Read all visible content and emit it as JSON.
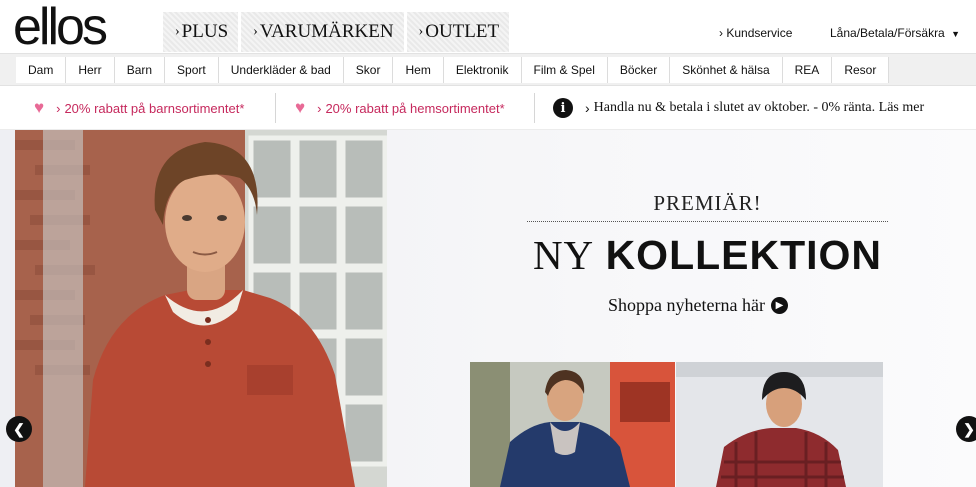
{
  "brand": {
    "logo_text": "ellos"
  },
  "main_tabs": [
    {
      "label": "PLUS"
    },
    {
      "label": "VARUMÄRKEN"
    },
    {
      "label": "OUTLET"
    }
  ],
  "utility": {
    "customer_service": "Kundservice",
    "loan_pay_insure": "Låna/Betala/Försäkra"
  },
  "categories": [
    "Dam",
    "Herr",
    "Barn",
    "Sport",
    "Underkläder & bad",
    "Skor",
    "Hem",
    "Elektronik",
    "Film & Spel",
    "Böcker",
    "Skönhet & hälsa",
    "REA",
    "Resor"
  ],
  "promos": {
    "kids_discount": "20% rabatt på barnsortimentet*",
    "home_discount": "20% rabatt på hemsortimentet*",
    "pay_later": "Handla nu & betala i slutet av oktober. - 0% ränta. Läs mer"
  },
  "hero": {
    "eyebrow": "PREMIÄR!",
    "headline_light": "NY",
    "headline_bold": "KOLLEKTION",
    "cta": "Shoppa nyheterna här"
  },
  "colors": {
    "promo_pink": "#c6295d",
    "heart_pink": "#e86a96",
    "sweater_red": "#b84a35"
  },
  "icons": {
    "tab_chevron": "›",
    "heart": "♥",
    "info": "i",
    "cta_arrow": "▶",
    "prev": "❮",
    "next": "❯",
    "dropdown": "▼"
  }
}
